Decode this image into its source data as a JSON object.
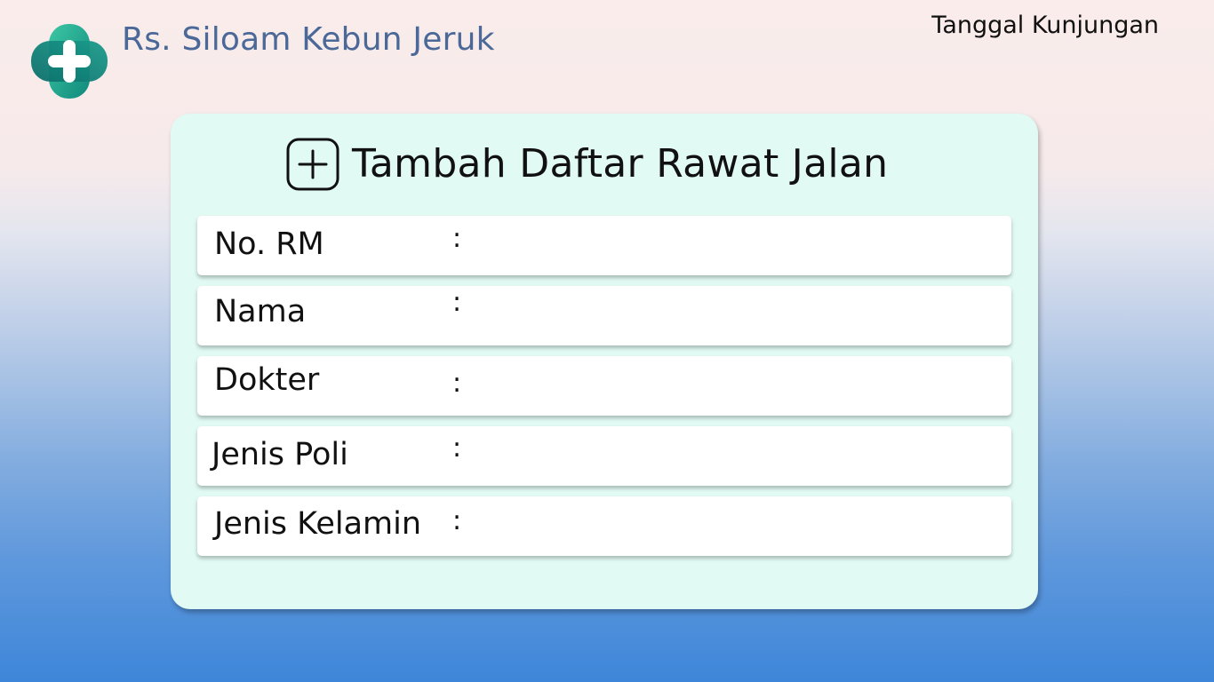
{
  "header": {
    "hospital_name": "Rs. Siloam Kebun Jeruk",
    "visit_date_label": "Tanggal Kunjungan",
    "logo_icon": "medical-cross-icon"
  },
  "form": {
    "title": "Tambah Daftar Rawat Jalan",
    "title_icon": "add-square-icon",
    "separator": ":",
    "fields": [
      {
        "label": "No. RM",
        "value": ""
      },
      {
        "label": "Nama",
        "value": ""
      },
      {
        "label": "Dokter",
        "value": ""
      },
      {
        "label": "Jenis Poli",
        "value": ""
      },
      {
        "label": "Jenis Kelamin",
        "value": ""
      }
    ]
  },
  "colors": {
    "brand_text": "#4a6898",
    "logo_teal": "#1fa790",
    "card_background": "#e1faf3",
    "background_top": "#f9eceb",
    "background_bottom": "#3e86d9"
  }
}
